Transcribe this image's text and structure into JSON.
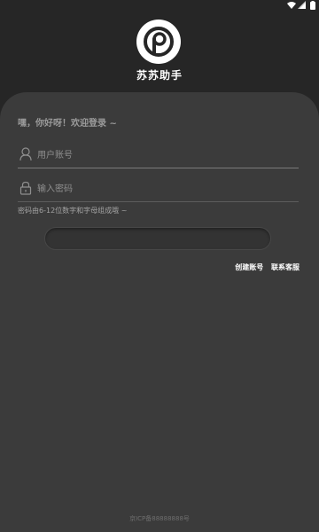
{
  "status_bar": {
    "icons": [
      "wifi-icon",
      "signal-icon",
      "battery-icon"
    ]
  },
  "header": {
    "logo_icon": "app-logo",
    "app_name": "苏苏助手"
  },
  "login": {
    "greeting": "嘿，你好呀！欢迎登录 ~",
    "username_placeholder": "用户账号",
    "username_value": "",
    "password_placeholder": "输入密码",
    "password_value": "",
    "password_hint": "密码由6-12位数字和字母组成哦 ~",
    "login_button_label": "",
    "create_account_label": "创建账号",
    "contact_service_label": "联系客服"
  },
  "footer": {
    "icp_text": "京ICP备88888888号"
  },
  "colors": {
    "background": "#262626",
    "card": "#3b3b3b",
    "text_primary": "#ffffff",
    "text_muted": "#9a9a9a"
  }
}
